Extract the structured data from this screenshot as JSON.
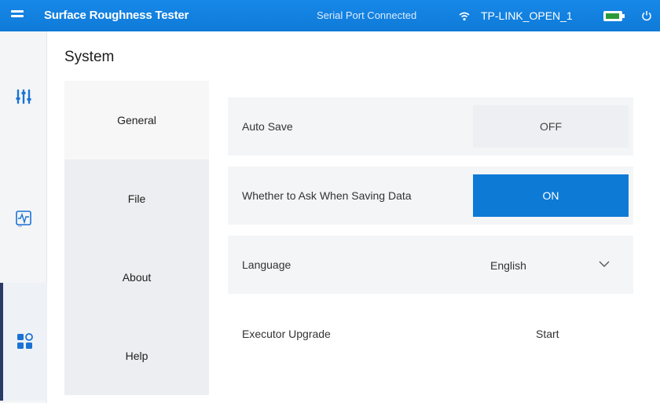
{
  "app": {
    "title": "Surface Roughness Tester",
    "serial_status": "Serial Port Connected",
    "network_name": "TP-LINK_OPEN_1",
    "accent_color": "#1788e8"
  },
  "rail": {
    "items": [
      {
        "icon": "sliders-icon"
      },
      {
        "icon": "waveform-icon"
      },
      {
        "icon": "grid-apps-icon"
      }
    ],
    "active_index": 2
  },
  "page": {
    "title": "System"
  },
  "subnav": {
    "items": [
      "General",
      "File",
      "About",
      "Help"
    ],
    "selected": "General"
  },
  "settings": {
    "auto_save": {
      "label": "Auto Save",
      "value": "OFF"
    },
    "ask_when_saving": {
      "label": "Whether to Ask When Saving Data",
      "value": "ON"
    },
    "language": {
      "label": "Language",
      "value": "English"
    },
    "executor_upgrade": {
      "label": "Executor Upgrade",
      "action": "Start"
    }
  }
}
